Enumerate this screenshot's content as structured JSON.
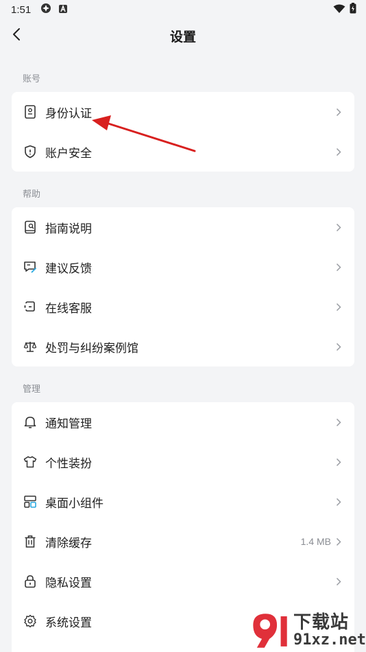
{
  "status_bar": {
    "time": "1:51",
    "left_icons": [
      "settings-gear-status-icon",
      "a-letter-status-icon"
    ],
    "right_icons": [
      "wifi-icon",
      "battery-icon"
    ]
  },
  "header": {
    "title": "设置",
    "back_icon": "chevron-left-icon"
  },
  "sections": [
    {
      "label": "账号",
      "items": [
        {
          "label": "身份认证",
          "icon": "id-card-icon",
          "value": ""
        },
        {
          "label": "账户安全",
          "icon": "shield-icon",
          "value": ""
        }
      ]
    },
    {
      "label": "帮助",
      "items": [
        {
          "label": "指南说明",
          "icon": "guide-book-icon",
          "value": ""
        },
        {
          "label": "建议反馈",
          "icon": "feedback-edit-icon",
          "value": ""
        },
        {
          "label": "在线客服",
          "icon": "customer-service-icon",
          "value": ""
        },
        {
          "label": "处罚与纠纷案例馆",
          "icon": "balance-scale-icon",
          "value": ""
        }
      ]
    },
    {
      "label": "管理",
      "items": [
        {
          "label": "通知管理",
          "icon": "bell-icon",
          "value": ""
        },
        {
          "label": "个性装扮",
          "icon": "shirt-icon",
          "value": ""
        },
        {
          "label": "桌面小组件",
          "icon": "widget-icon",
          "value": ""
        },
        {
          "label": "清除缓存",
          "icon": "trash-icon",
          "value": "1.4 MB"
        },
        {
          "label": "隐私设置",
          "icon": "lock-icon",
          "value": ""
        },
        {
          "label": "系统设置",
          "icon": "gear-icon",
          "value": ""
        }
      ]
    }
  ],
  "watermark": {
    "logo_text": "下载站",
    "domain": "91xz.net"
  },
  "colors": {
    "background": "#f3f4f6",
    "card": "#ffffff",
    "secondary_text": "#8a8d93",
    "annotation_arrow": "#d8201f",
    "watermark_accent": "#e0303a"
  }
}
